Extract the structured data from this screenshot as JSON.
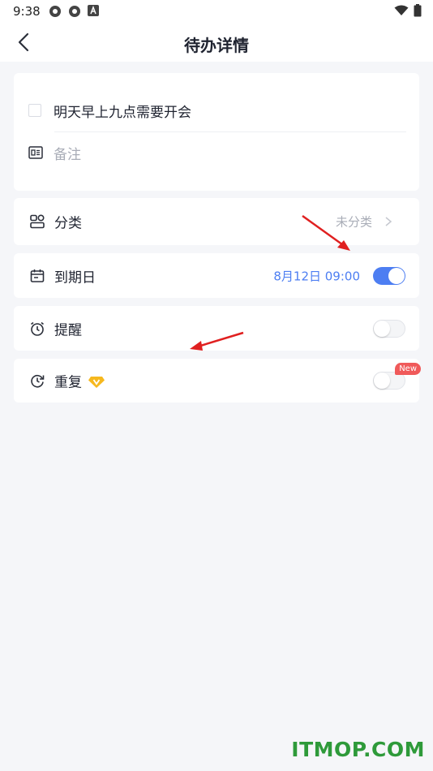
{
  "status_bar": {
    "time": "9:38",
    "left_icons": [
      "settings-flower-icon",
      "settings-flower-icon",
      "font-a-icon"
    ],
    "right_icons": [
      "wifi-icon",
      "battery-icon"
    ]
  },
  "nav": {
    "back_icon": "chevron-left-icon",
    "title": "待办详情"
  },
  "task": {
    "checked": false,
    "title": "明天早上九点需要开会",
    "note_placeholder": "备注"
  },
  "category": {
    "label": "分类",
    "value": "未分类",
    "icon": "category-icon"
  },
  "due_date": {
    "label": "到期日",
    "value": "8月12日 09:00",
    "enabled": true,
    "icon": "calendar-icon"
  },
  "reminder": {
    "label": "提醒",
    "enabled": false,
    "icon": "alarm-icon"
  },
  "repeat": {
    "label": "重复",
    "enabled": false,
    "badge": "New",
    "vip_icon": "vip-diamond-icon",
    "icon": "repeat-clock-icon"
  },
  "watermark": "ITMOP.COM",
  "colors": {
    "accent": "#4d7ef2",
    "background": "#f5f6f9",
    "badge": "#f05a5a",
    "watermark": "#2e9a3a",
    "annotation_arrow": "#e02020"
  }
}
